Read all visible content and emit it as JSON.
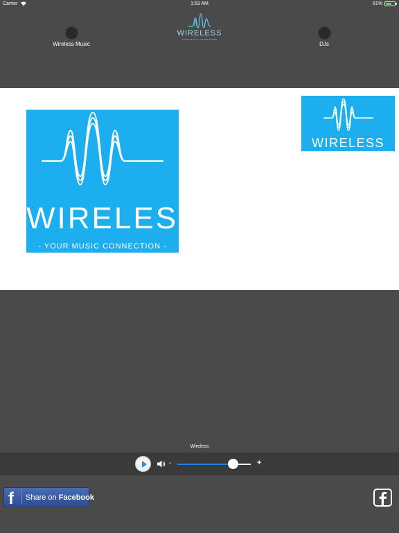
{
  "status_bar": {
    "carrier": "Carrier",
    "time": "1:53 AM",
    "battery": "61%"
  },
  "header": {
    "nav_left": "Wireless Music",
    "nav_right": "DJs",
    "logo_word": "WIRELESS",
    "logo_tagline": "YOUR MUSIC CONNECTION"
  },
  "content": {
    "big_logo_word": "WIRELESS",
    "big_logo_tagline": "- YOUR MUSIC CONNECTION -",
    "small_logo_word": "WIRELESS"
  },
  "player": {
    "station_name": "Wireless",
    "volume_minus": "-",
    "volume_plus": "+",
    "volume_level": 0.75
  },
  "footer": {
    "share_prefix": "Share on ",
    "share_brand": "Facebook",
    "share_f": "f"
  },
  "colors": {
    "brand_blue": "#1daef0",
    "header_bg": "#4a4a4a",
    "player_bg": "#3a3a3a",
    "facebook_blue": "#3b5998"
  }
}
